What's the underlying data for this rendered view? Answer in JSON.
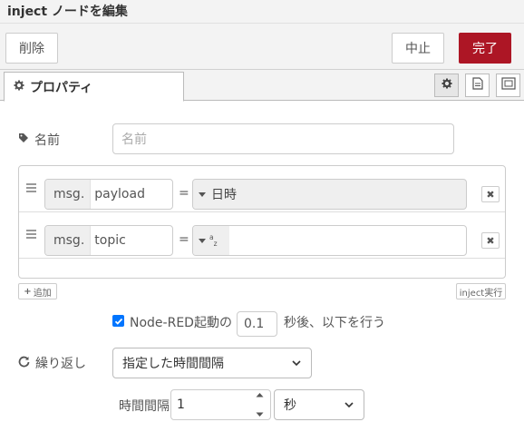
{
  "title": "inject ノードを編集",
  "toolbar": {
    "delete_label": "削除",
    "cancel_label": "中止",
    "done_label": "完了"
  },
  "tabs": [
    {
      "label": "プロパティ",
      "icon": "gear-icon"
    }
  ],
  "tab_buttons": [
    {
      "icon": "gear-icon",
      "active": true
    },
    {
      "icon": "document-icon",
      "active": false
    },
    {
      "icon": "layout-icon",
      "active": false
    }
  ],
  "name": {
    "label": "名前",
    "placeholder": "名前",
    "value": ""
  },
  "props": [
    {
      "prefix": "msg.",
      "key": "payload",
      "eq": "=",
      "value": "日時",
      "type_icon": "caret-down-icon"
    },
    {
      "prefix": "msg.",
      "key": "topic",
      "eq": "=",
      "value": "",
      "type_icon": "string-az-icon",
      "type_text": "az"
    }
  ],
  "add_button": "追加",
  "inject_button": "inject実行",
  "once": {
    "checked": true,
    "label": "Node-RED起動の",
    "delay": "0.1",
    "suffix": "秒後、以下を行う"
  },
  "repeat": {
    "label": "繰り返し",
    "selected": "指定した時間間隔"
  },
  "interval": {
    "label": "時間間隔",
    "value": "1",
    "unit": "秒"
  },
  "colors": {
    "accent": "#ad1625",
    "border": "#cccccc",
    "bg_header": "#f3f3f3"
  }
}
